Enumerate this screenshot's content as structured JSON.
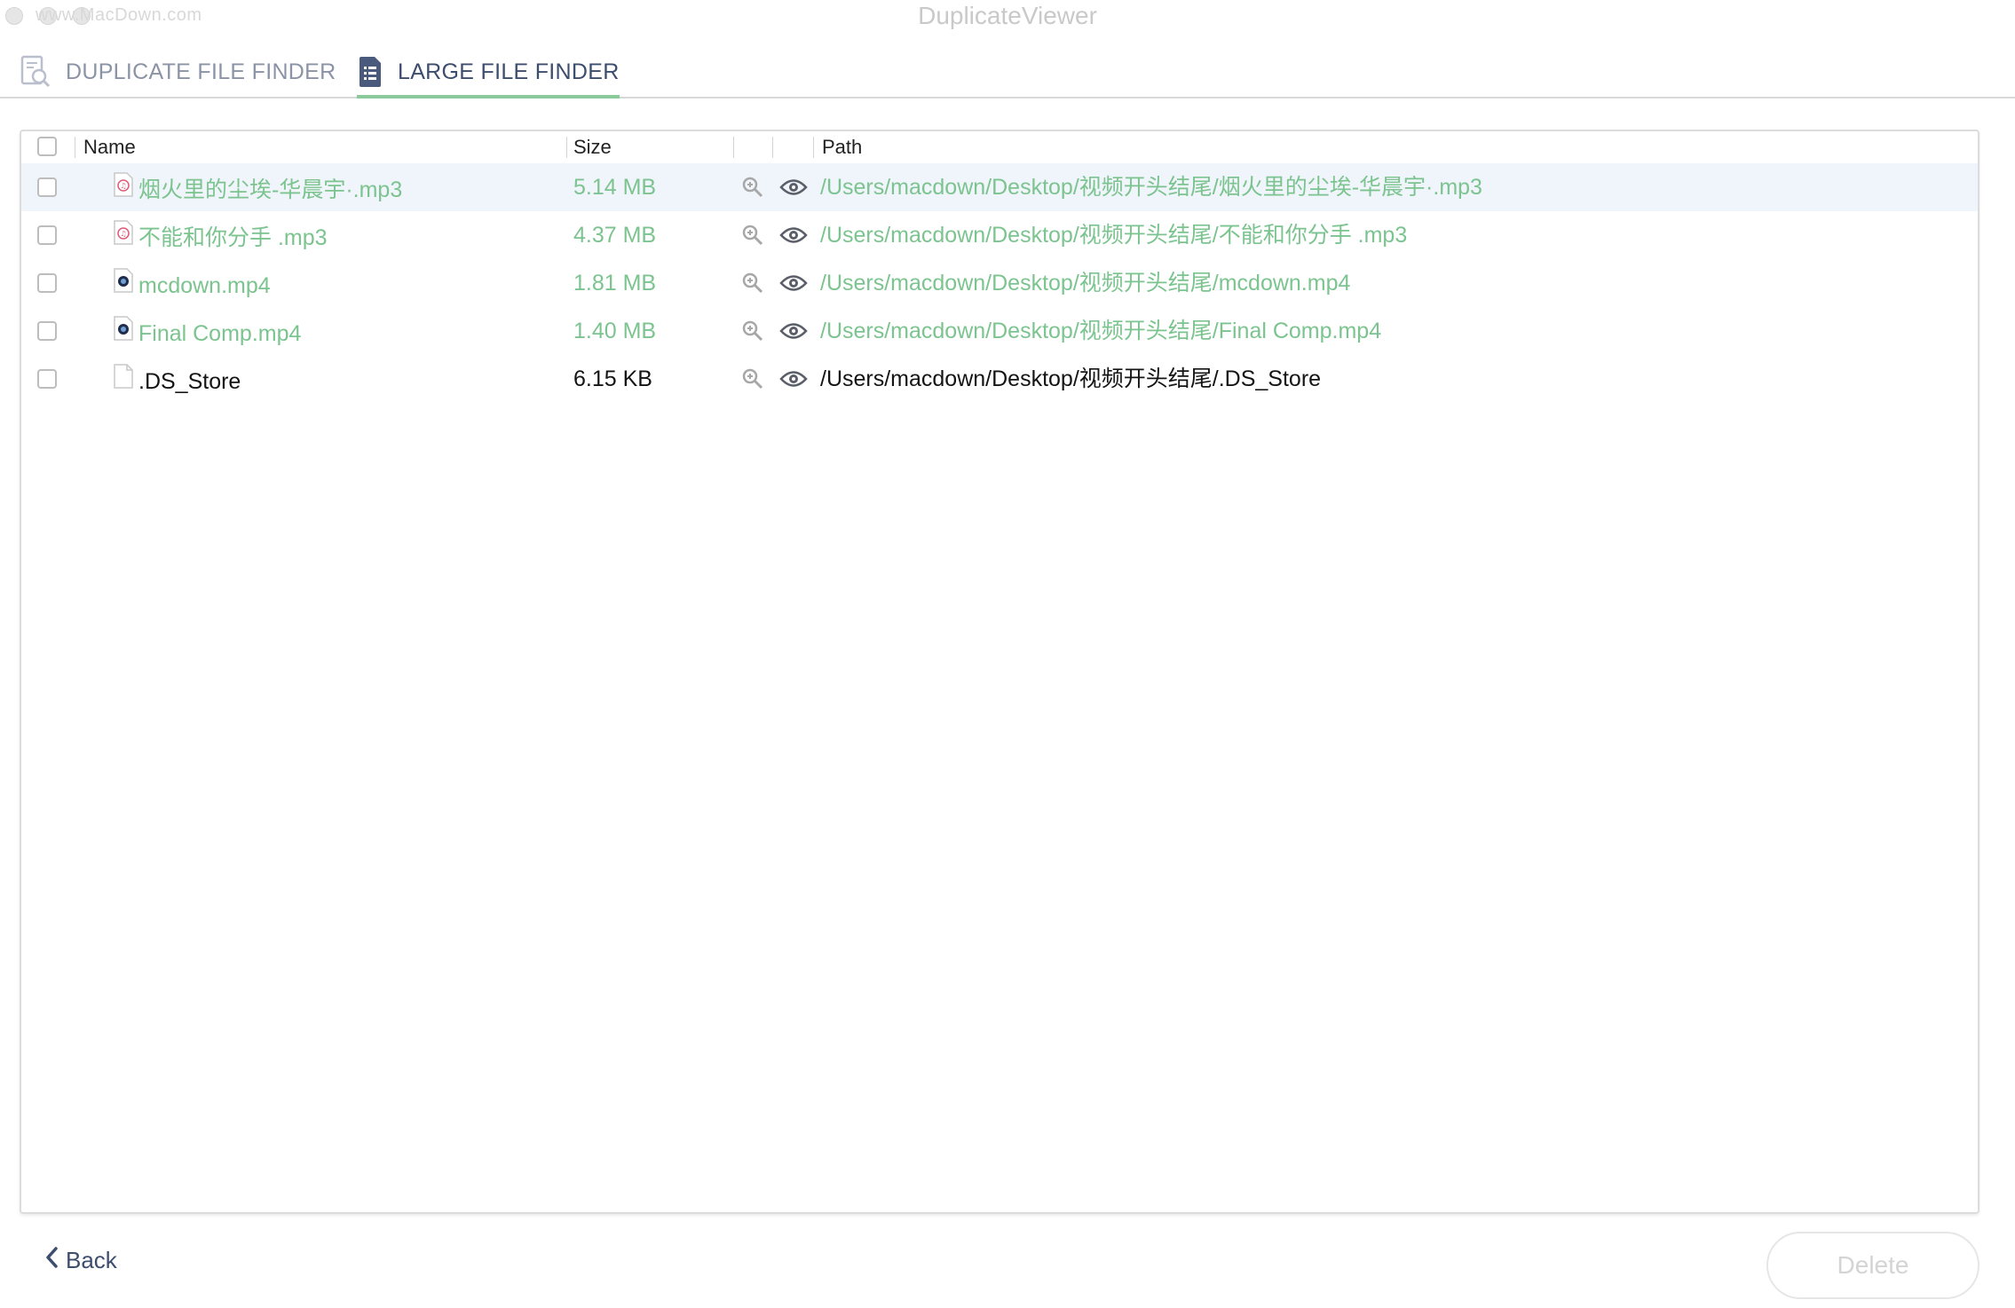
{
  "window": {
    "title": "DuplicateViewer",
    "watermark": "www.MacDown.com"
  },
  "tabs": [
    {
      "label": "DUPLICATE FILE FINDER",
      "icon": "duplicate-search-icon",
      "active": false
    },
    {
      "label": "LARGE FILE FINDER",
      "icon": "document-list-icon",
      "active": true
    }
  ],
  "table": {
    "headers": {
      "name": "Name",
      "size": "Size",
      "path": "Path"
    },
    "rows": [
      {
        "name": "烟火里的尘埃-华晨宇·.mp3",
        "size": "5.14 MB",
        "path": "/Users/macdown/Desktop/视频开头结尾/烟火里的尘埃-华晨宇·.mp3",
        "type": "audio",
        "color": "#7cc48f",
        "selected": true
      },
      {
        "name": "不能和你分手 .mp3",
        "size": "4.37 MB",
        "path": "/Users/macdown/Desktop/视频开头结尾/不能和你分手 .mp3",
        "type": "audio",
        "color": "#7cc48f",
        "selected": false
      },
      {
        "name": "mcdown.mp4",
        "size": "1.81 MB",
        "path": "/Users/macdown/Desktop/视频开头结尾/mcdown.mp4",
        "type": "video",
        "color": "#7cc48f",
        "selected": false
      },
      {
        "name": "Final Comp.mp4",
        "size": "1.40 MB",
        "path": "/Users/macdown/Desktop/视频开头结尾/Final Comp.mp4",
        "type": "video",
        "color": "#7cc48f",
        "selected": false
      },
      {
        "name": ".DS_Store",
        "size": "6.15 KB",
        "path": "/Users/macdown/Desktop/视频开头结尾/.DS_Store",
        "type": "generic",
        "color": "#141414",
        "selected": false
      }
    ]
  },
  "footer": {
    "back_label": "Back",
    "delete_label": "Delete"
  },
  "colors": {
    "accent_green": "#7cc48f",
    "tab_active": "#3d4d6e",
    "tab_inactive": "#8b93a6"
  }
}
